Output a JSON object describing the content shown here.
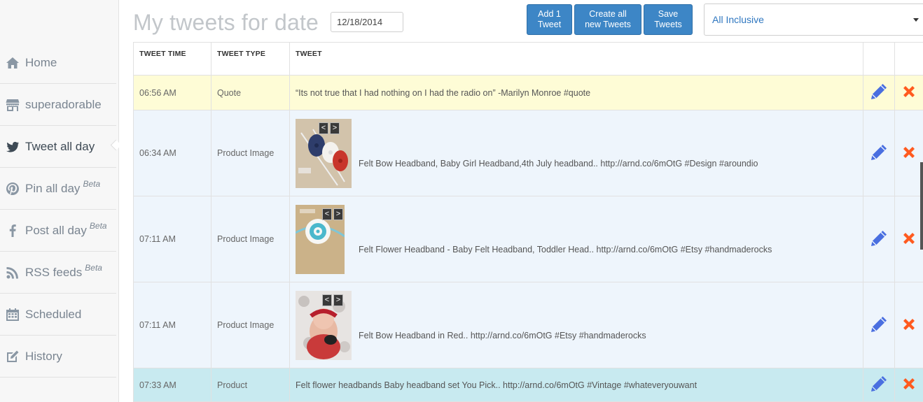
{
  "sidebar": {
    "items": [
      {
        "label": "Home",
        "icon": "home-icon",
        "beta": ""
      },
      {
        "label": "superadorable",
        "icon": "store-icon",
        "beta": ""
      },
      {
        "label": "Tweet all day",
        "icon": "twitter-icon",
        "beta": "",
        "active": true
      },
      {
        "label": "Pin all day",
        "icon": "pinterest-icon",
        "beta": "Beta"
      },
      {
        "label": "Post all day",
        "icon": "facebook-icon",
        "beta": "Beta"
      },
      {
        "label": "RSS feeds",
        "icon": "rss-icon",
        "beta": "Beta"
      },
      {
        "label": "Scheduled",
        "icon": "calendar-icon",
        "beta": ""
      },
      {
        "label": "History",
        "icon": "edit-icon",
        "beta": ""
      }
    ]
  },
  "header": {
    "title": "My tweets for date",
    "date_value": "12/18/2014",
    "buttons": {
      "add": "Add 1\nTweet",
      "create": "Create all\nnew Tweets",
      "save": "Save\nTweets"
    },
    "filter_selected": "All Inclusive"
  },
  "table": {
    "columns": [
      "TWEET TIME",
      "TWEET TYPE",
      "TWEET"
    ],
    "rows": [
      {
        "time": "06:56 AM",
        "type": "Quote",
        "tweet": "“Its not true that I had nothing on I had the radio on” -Marilyn Monroe #quote"
      },
      {
        "time": "06:34 AM",
        "type": "Product Image",
        "tweet": "Felt Bow Headband, Baby Girl Headband,4th July headband.. http://arnd.co/6mOtG #Design #aroundio"
      },
      {
        "time": "07:11 AM",
        "type": "Product Image",
        "tweet": "Felt Flower Headband - Baby Felt Headband, Toddler Head.. http://arnd.co/6mOtG #Etsy #handmaderocks"
      },
      {
        "time": "07:11 AM",
        "type": "Product Image",
        "tweet": "Felt Bow Headband in Red.. http://arnd.co/6mOtG #Etsy #handmaderocks"
      },
      {
        "time": "07:33 AM",
        "type": "Product",
        "tweet": "Felt flower headbands Baby headband set You Pick.. http://arnd.co/6mOtG #Vintage #whateveryouwant"
      }
    ],
    "arrow_prev": "<",
    "arrow_next": ">"
  },
  "colors": {
    "accent": "#3d86c6",
    "edit_icon": "#4a6fe0",
    "delete_icon": "#ff5a1f",
    "quote_row": "#fefcd6",
    "image_row": "#eef5fc",
    "product_row": "#c8eaf0"
  }
}
